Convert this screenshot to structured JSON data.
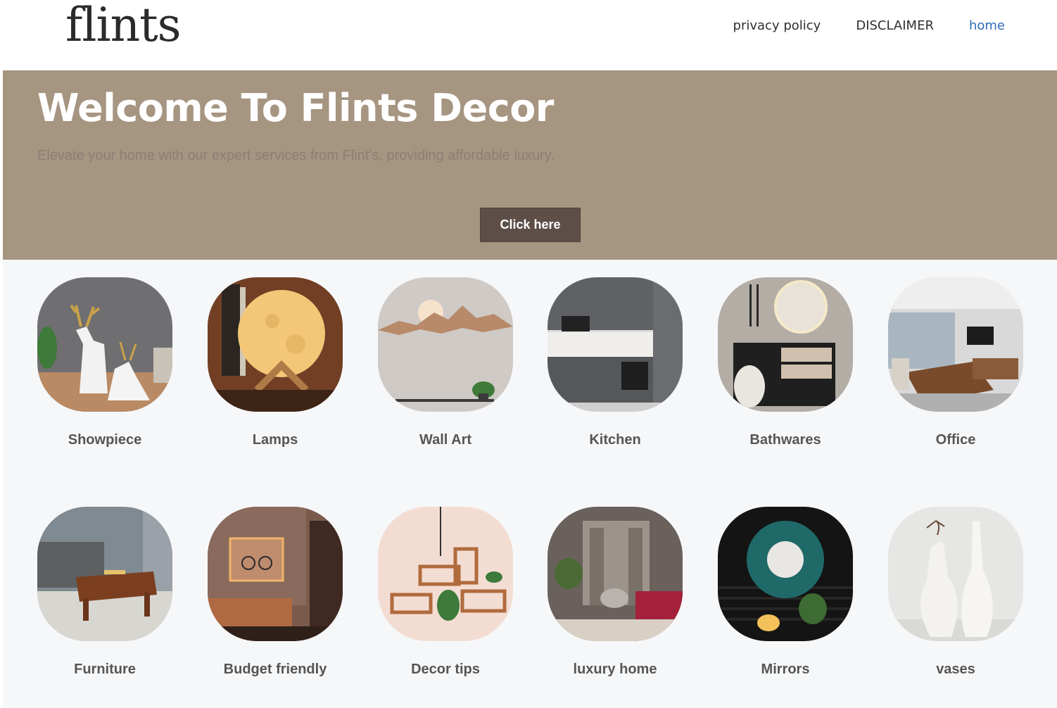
{
  "header": {
    "logo_text": "flints",
    "nav": [
      {
        "label": "privacy policy",
        "active": false
      },
      {
        "label": "DISCLAIMER",
        "active": false
      },
      {
        "label": "home",
        "active": true
      }
    ]
  },
  "hero": {
    "title": "Welcome To Flints Decor",
    "subtitle": "Elevate your home with our expert services from Flint’s, providing affordable luxury.",
    "button_label": "Click here",
    "colors": {
      "background": "#a69581",
      "button": "#5e4e48"
    }
  },
  "categories": [
    {
      "label": "Showpiece",
      "icon": "deer-figurine-image"
    },
    {
      "label": "Lamps",
      "icon": "moon-lamp-image"
    },
    {
      "label": "Wall Art",
      "icon": "mountain-wall-art-image"
    },
    {
      "label": "Kitchen",
      "icon": "kitchen-image"
    },
    {
      "label": "Bathwares",
      "icon": "bathroom-vanity-image"
    },
    {
      "label": "Office",
      "icon": "office-room-image"
    },
    {
      "label": "Furniture",
      "icon": "coffee-table-image"
    },
    {
      "label": "Budget friendly",
      "icon": "living-room-image"
    },
    {
      "label": "Decor tips",
      "icon": "wall-shelves-image"
    },
    {
      "label": "luxury home",
      "icon": "luxury-lounge-image"
    },
    {
      "label": "Mirrors",
      "icon": "round-mirror-image"
    },
    {
      "label": "vases",
      "icon": "white-vases-image"
    }
  ]
}
